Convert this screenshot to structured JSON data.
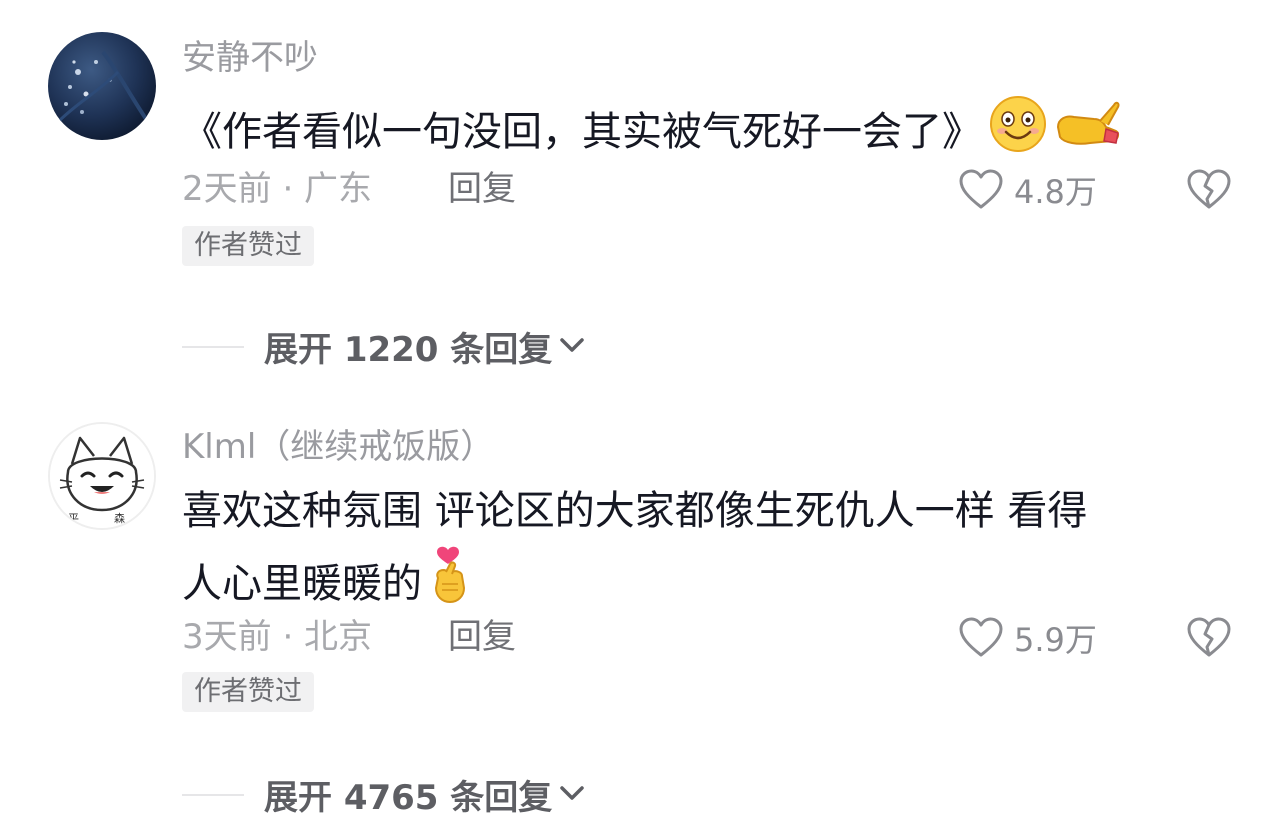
{
  "comments": [
    {
      "username": "安静不吵",
      "text": "《作者看似一句没回，其实被气死好一会了》",
      "emojis": [
        "grinning-face-emoji",
        "pointing-finger-emoji"
      ],
      "time_location": "2天前 · 广东",
      "reply_label": "回复",
      "likes": "4.8万",
      "badge": "作者赞过",
      "expand_label": "展开 1220 条回复"
    },
    {
      "username": "Klml（继续戒饭版）",
      "text_line1": "喜欢这种氛围 评论区的大家都像生死仇人一样 看得",
      "text_line2": "人心里暖暖的",
      "emojis": [
        "finger-heart-emoji"
      ],
      "time_location": "3天前 · 北京",
      "reply_label": "回复",
      "likes": "5.9万",
      "badge": "作者赞过",
      "expand_label": "展开 4765 条回复"
    }
  ],
  "icons": {
    "like": "heart-outline-icon",
    "dislike": "broken-heart-icon",
    "expand": "chevron-down-icon"
  }
}
